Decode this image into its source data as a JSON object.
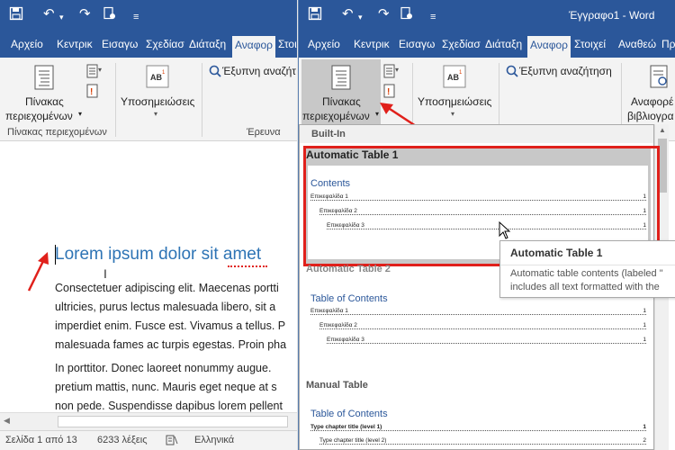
{
  "left_window": {
    "tabs": [
      "Αρχείο",
      "Κεντρικ",
      "Εισαγω",
      "Σχεδίασ",
      "Διάταξη",
      "Αναφορ",
      "Στοιχε"
    ],
    "active_tab_index": 5,
    "ribbon": {
      "toc_button_label": [
        "Πίνακας",
        "περιεχομένων"
      ],
      "toc_group_label": "Πίνακας περιεχομένων",
      "footnotes_label": "Υποσημειώσεις",
      "footnote_icon_text": "AB",
      "smart_lookup_label": "Έξυπνη αναζήτ",
      "research_group_label": "Έρευνα"
    },
    "document": {
      "heading": "Lorem ipsum dolor sit amet",
      "para1": [
        "Consectetuer adipiscing elit. Maecenas portti",
        "ultricies, purus lectus malesuada libero, sit a",
        "imperdiet enim. Fusce est. Vivamus a tellus. P",
        "malesuada fames ac turpis egestas. Proin pha"
      ],
      "para2": [
        "In porttitor. Donec laoreet nonummy augue.",
        "pretium mattis, nunc. Mauris eget neque at s",
        "non pede. Suspendisse dapibus lorem pellent"
      ]
    },
    "status": {
      "page": "Σελίδα 1 από 13",
      "words": "6233 λέξεις",
      "language": "Ελληνικά"
    }
  },
  "right_window": {
    "title": "Έγγραφο1  -  Word",
    "tabs": [
      "Αρχείο",
      "Κεντρικ",
      "Εισαγω",
      "Σχεδίασ",
      "Διάταξη",
      "Αναφορ",
      "Στοιχεί",
      "Αναθεώ",
      "Πρ"
    ],
    "active_tab_index": 5,
    "ribbon": {
      "toc_button_label": [
        "Πίνακας",
        "περιεχομένων"
      ],
      "footnotes_label": "Υποσημειώσεις",
      "footnote_icon_text": "AB",
      "smart_lookup_label": "Έξυπνη αναζήτηση",
      "citations_label": [
        "Αναφορέ",
        "βιβλιογρα"
      ]
    },
    "gallery": {
      "section_builtin": "Built-In",
      "auto_table_1": {
        "title": "Automatic Table 1",
        "preview_heading": "Contents",
        "rows": [
          {
            "text": "Επικεφαλίδα 1",
            "page": "1"
          },
          {
            "text": "Επικεφαλίδα 2",
            "page": "1"
          },
          {
            "text": "Επικεφαλίδα 3",
            "page": "1"
          }
        ]
      },
      "auto_table_2": {
        "title": "Automatic Table 2",
        "preview_heading": "Table of Contents",
        "rows": [
          {
            "text": "Επικεφαλίδα 1",
            "page": "1"
          },
          {
            "text": "Επικεφαλίδα 2",
            "page": "1"
          },
          {
            "text": "Επικεφαλίδα 3",
            "page": "1"
          }
        ]
      },
      "manual_table": {
        "title": "Manual Table",
        "preview_heading": "Table of Contents",
        "rows": [
          {
            "text": "Type chapter title (level 1)",
            "page": "1"
          },
          {
            "text": "Type chapter title (level 2)",
            "page": "2"
          }
        ]
      }
    },
    "tooltip": {
      "title": "Automatic Table 1",
      "lines": [
        "Automatic table contents (labeled \"",
        "includes all text formatted with the"
      ]
    }
  },
  "colors": {
    "word_blue": "#2b579a",
    "highlight_red": "#e0201b",
    "selected_gray": "#c8c8c8"
  }
}
